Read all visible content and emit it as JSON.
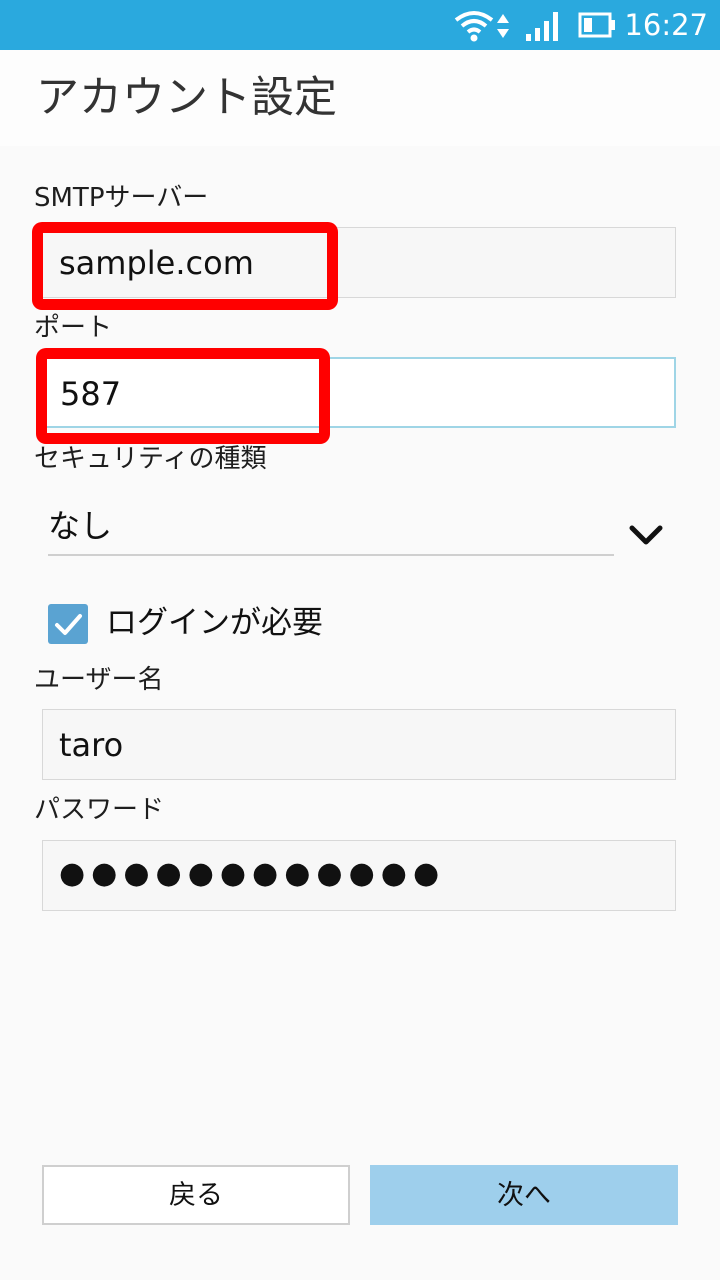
{
  "status_bar": {
    "time": "16:27",
    "icons": [
      "wifi-icon",
      "data-transfer-icon",
      "signal-icon",
      "battery-icon"
    ]
  },
  "header": {
    "title": "アカウント設定"
  },
  "form": {
    "smtp_server": {
      "label": "SMTPサーバー",
      "value": "sample.com"
    },
    "port": {
      "label": "ポート",
      "value": "587"
    },
    "security": {
      "label": "セキュリティの種類",
      "value": "なし"
    },
    "login_required": {
      "label": "ログインが必要",
      "checked": true
    },
    "username": {
      "label": "ユーザー名",
      "value": "taro"
    },
    "password": {
      "label": "パスワード",
      "value": "●●●●●●●●●●●●"
    }
  },
  "buttons": {
    "back": "戻る",
    "next": "次へ"
  },
  "colors": {
    "status_bar": "#2aa9de",
    "highlight": "#ff0000",
    "checkbox": "#5aa3d2",
    "next_button": "#9ecfec",
    "focus_border": "#9fd5e6"
  }
}
